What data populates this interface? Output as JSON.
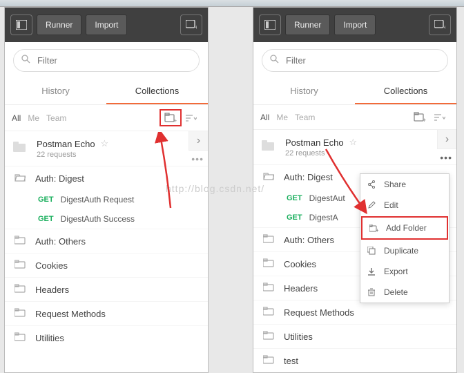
{
  "toolbar": {
    "runner": "Runner",
    "import": "Import"
  },
  "filter": {
    "placeholder": "Filter"
  },
  "tabs": {
    "history": "History",
    "collections": "Collections"
  },
  "filters": {
    "all": "All",
    "me": "Me",
    "team": "Team"
  },
  "collection": {
    "name": "Postman Echo",
    "count": "22 requests"
  },
  "folders": {
    "auth_digest": "Auth: Digest",
    "auth_others": "Auth: Others",
    "cookies": "Cookies",
    "headers": "Headers",
    "request_methods": "Request Methods",
    "utilities": "Utilities",
    "test": "test"
  },
  "requests": {
    "get": "GET",
    "digest_req": "DigestAuth Request",
    "digest_succ": "DigestAuth Success",
    "digest_short": "DigestAut",
    "digest_succ_short": "DigestA"
  },
  "menu": {
    "share": "Share",
    "edit": "Edit",
    "add_folder": "Add Folder",
    "duplicate": "Duplicate",
    "export": "Export",
    "delete": "Delete"
  },
  "watermark": "http://blog.csdn.net/"
}
